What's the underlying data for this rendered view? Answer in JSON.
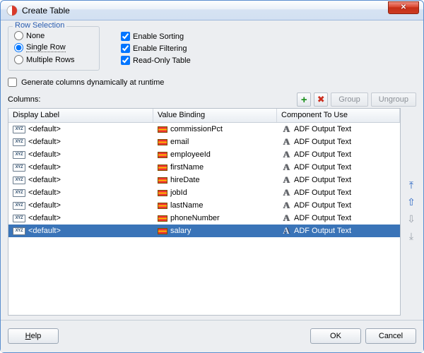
{
  "window": {
    "title": "Create Table"
  },
  "rowSelection": {
    "legend": "Row Selection",
    "options": {
      "none": "None",
      "single": "Single Row",
      "multiple": "Multiple Rows"
    },
    "selected": "single"
  },
  "features": {
    "sorting": "Enable Sorting",
    "filtering": "Enable Filtering",
    "readonly": "Read-Only Table"
  },
  "dynamicColumns": "Generate columns dynamically at runtime",
  "columns": {
    "label": "Columns:",
    "groupBtn": "Group",
    "ungroupBtn": "Ungroup",
    "headers": {
      "display": "Display Label",
      "binding": "Value Binding",
      "component": "Component To Use"
    },
    "defaultLabel": "<default>",
    "componentText": "ADF Output Text",
    "rows": [
      {
        "binding": "commissionPct",
        "selected": false
      },
      {
        "binding": "email",
        "selected": false
      },
      {
        "binding": "employeeId",
        "selected": false
      },
      {
        "binding": "firstName",
        "selected": false
      },
      {
        "binding": "hireDate",
        "selected": false
      },
      {
        "binding": "jobId",
        "selected": false
      },
      {
        "binding": "lastName",
        "selected": false
      },
      {
        "binding": "phoneNumber",
        "selected": false
      },
      {
        "binding": "salary",
        "selected": true
      }
    ]
  },
  "buttons": {
    "help": "Help",
    "ok": "OK",
    "cancel": "Cancel"
  },
  "icons": {
    "plus": "+",
    "delete": "✖",
    "top": "⤒",
    "up": "⇧",
    "down": "⇩",
    "bottom": "⤓"
  }
}
